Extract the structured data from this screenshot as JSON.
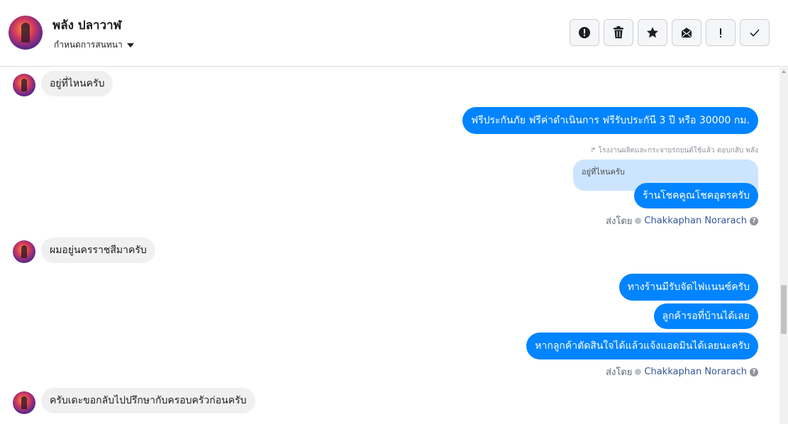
{
  "header": {
    "contact_name": "พลัง ปลาวาฬ",
    "assign_label": "กำหนดการสนทนา",
    "tools": [
      {
        "icon": "alert-circle-icon",
        "label": "Spam"
      },
      {
        "icon": "trash-icon",
        "label": "Delete"
      },
      {
        "icon": "star-icon",
        "label": "Star"
      },
      {
        "icon": "envelope-icon",
        "label": "Mark unread"
      },
      {
        "icon": "exclamation-icon",
        "label": "Follow up"
      },
      {
        "icon": "check-icon",
        "label": "Done"
      }
    ]
  },
  "messages": {
    "m1": "อยู่ที่ไหนครับ",
    "m2": "ฟรีประกันภัย ฟรีค่าดำเนินการ ฟรีรับประกันี 3 ปี หรือ 30000 กม.",
    "reply_meta": "โรงงานผลิตและกระจายรถยนต์ใช้แล้ว ตอบกลับ พลัง",
    "quote": "อยู่ที่ไหนครับ",
    "m3": "ร้านโชคคูณโชคอุดรครับ",
    "m4": "ผมอยู่นครราชสีมาครับ",
    "m5": "ทางร้านมีรับจัดไฟแนนซ์ครับ",
    "m6": "ลูกค้ารอที่บ้านได้เลย",
    "m7": "หากลูกค้าตัดสินใจได้แล้วแจ้งแอดมินได้เลยนะครับ",
    "m8": "ครับเดะขอกลับไปปรึกษากับครอบครัวก่อนครับ"
  },
  "sent_by": {
    "prefix": "ส่งโดย",
    "agent": "Chakkaphan Norarach"
  },
  "colors": {
    "outgoing_bubble": "#0084ff",
    "incoming_bubble": "#f0f0f0",
    "quote_bubble": "#cce4ff"
  }
}
